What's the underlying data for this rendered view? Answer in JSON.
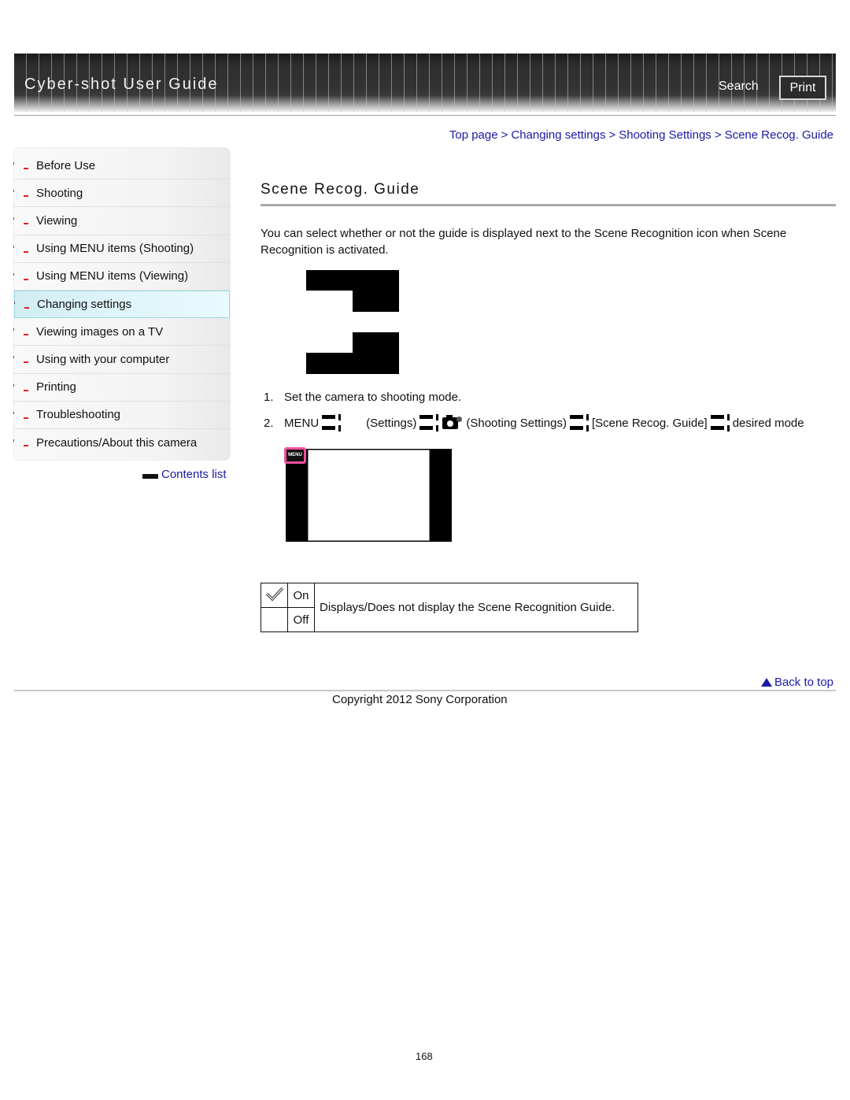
{
  "header": {
    "title": "Cyber-shot User Guide",
    "search_label": "Search",
    "print_label": "Print"
  },
  "breadcrumb": [
    {
      "label": "Top page"
    },
    {
      "label": "Changing settings"
    },
    {
      "label": "Shooting Settings"
    },
    {
      "label": "Scene Recog. Guide"
    }
  ],
  "breadcrumb_separator": ">",
  "sidebar": {
    "items": [
      {
        "label": "Before Use",
        "active": false
      },
      {
        "label": "Shooting",
        "active": false
      },
      {
        "label": "Viewing",
        "active": false
      },
      {
        "label": "Using MENU items (Shooting)",
        "active": false
      },
      {
        "label": "Using MENU items (Viewing)",
        "active": false
      },
      {
        "label": "Changing settings",
        "active": true
      },
      {
        "label": "Viewing images on a TV",
        "active": false
      },
      {
        "label": "Using with your computer",
        "active": false
      },
      {
        "label": "Printing",
        "active": false
      },
      {
        "label": "Troubleshooting",
        "active": false
      },
      {
        "label": "Precautions/About this camera",
        "active": false
      }
    ],
    "contents_link": "Contents list"
  },
  "main": {
    "title": "Scene Recog. Guide",
    "intro": "You can select whether or not the guide is displayed next to the Scene Recognition icon when Scene Recognition is activated.",
    "steps": [
      {
        "num": "1.",
        "text": "Set the camera to shooting mode."
      },
      {
        "num": "2.",
        "parts": [
          "MENU",
          "(Settings)",
          "(Shooting Settings)",
          "[Scene Recog. Guide]",
          "desired mode"
        ]
      }
    ],
    "figure_menu_label": "MENU",
    "options": [
      {
        "value": "On",
        "default": true,
        "icon": "checkmark-icon"
      },
      {
        "value": "Off",
        "default": false
      }
    ],
    "options_description": "Displays/Does not display the Scene Recognition Guide."
  },
  "footer": {
    "back_to_top": "Back to top",
    "copyright": "Copyright 2012 Sony Corporation",
    "page_number": "168"
  },
  "colors": {
    "link": "#1a1aa6",
    "bullet": "#e02020",
    "active_item_bg": "#e3f7fb",
    "highlight_frame": "#f0509a"
  }
}
